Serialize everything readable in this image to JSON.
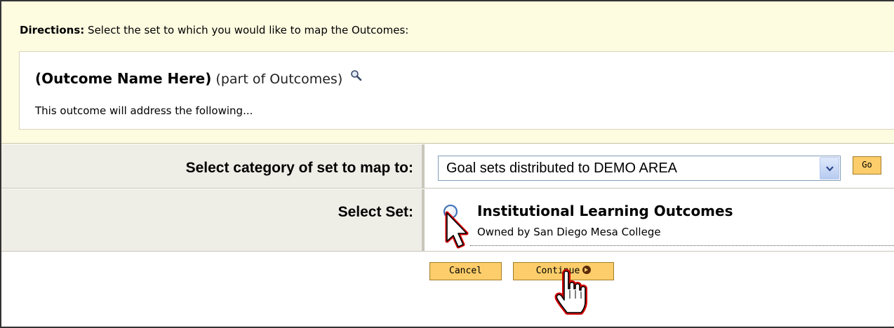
{
  "directions": {
    "label": "Directions:",
    "text": " Select the set to which you would like to map the Outcomes:"
  },
  "outcome": {
    "name": "(Outcome Name Here)",
    "part": " (part of Outcomes)",
    "description": "This outcome will address the following...",
    "icon": "magnifier-icon"
  },
  "form": {
    "category_label": "Select category of set to map to:",
    "category_selected": "Goal sets distributed to DEMO AREA",
    "go_label": "Go",
    "set_label": "Select Set:",
    "sets": [
      {
        "title": "Institutional Learning Outcomes",
        "owner": "Owned by San Diego Mesa College"
      }
    ]
  },
  "actions": {
    "cancel_label": "Cancel",
    "continue_label": "Continue"
  },
  "colors": {
    "directions_bg": "#fdfbe0",
    "label_bg": "#eeede6",
    "button_bg": "#fccd6a",
    "cursor_highlight": "#d40000"
  }
}
